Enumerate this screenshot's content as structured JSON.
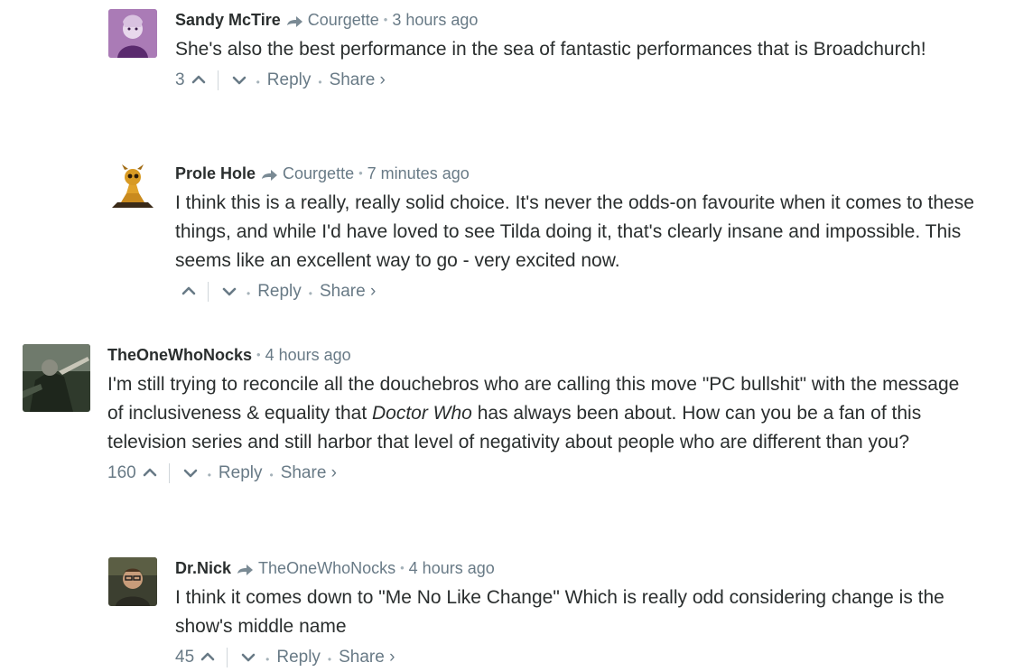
{
  "comments": [
    {
      "author": "Sandy McTire",
      "parent": "Courgette",
      "time": "3 hours ago",
      "text": "She's also the best performance in the sea of fantastic performances that is Broadchurch!",
      "votes": "3",
      "reply_label": "Reply",
      "share_label": "Share ›"
    },
    {
      "author": "Prole Hole",
      "parent": "Courgette",
      "time": "7 minutes ago",
      "text": "I think this is a really, really solid choice. It's never the odds-on favourite when it comes to these things, and while I'd have loved to see Tilda doing it, that's clearly insane and impossible. This seems like an excellent way to go - very excited now.",
      "votes": "",
      "reply_label": "Reply",
      "share_label": "Share ›"
    },
    {
      "author": "TheOneWhoNocks",
      "time": "4 hours ago",
      "text_before": "I'm still trying to reconcile all the douchebros who are calling this move \"PC bullshit\" with the message of inclusiveness & equality that ",
      "text_em": "Doctor Who",
      "text_after": " has always been about. How can you be a fan of this television series and still harbor that level of negativity about people who are different than you?",
      "votes": "160",
      "reply_label": "Reply",
      "share_label": "Share ›"
    },
    {
      "author": "Dr.Nick",
      "parent": "TheOneWhoNocks",
      "time": "4 hours ago",
      "text": "I think it comes down to \"Me No Like Change\" Which is really odd considering change is the show's middle name",
      "votes": "45",
      "reply_label": "Reply",
      "share_label": "Share ›"
    }
  ],
  "icons": {
    "reply_arrow": "reply-arrow-icon",
    "upvote": "chevron-up-icon",
    "downvote": "chevron-down-icon"
  }
}
